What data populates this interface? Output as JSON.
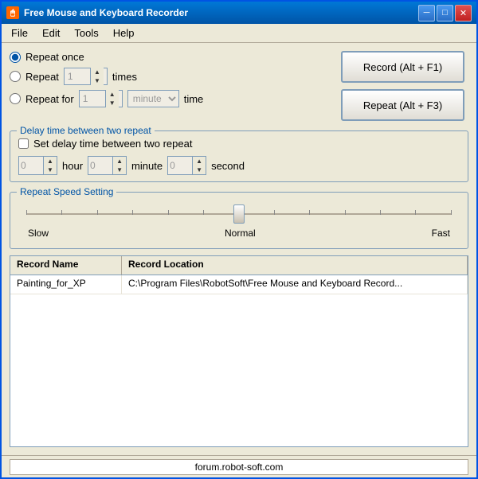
{
  "window": {
    "title": "Free Mouse and Keyboard Recorder",
    "icon": "🖱"
  },
  "titlebar": {
    "minimize_label": "─",
    "maximize_label": "□",
    "close_label": "✕"
  },
  "menu": {
    "items": [
      {
        "label": "File"
      },
      {
        "label": "Edit"
      },
      {
        "label": "Tools"
      },
      {
        "label": "Help"
      }
    ]
  },
  "controls": {
    "repeat_once_label": "Repeat once",
    "repeat_label": "Repeat",
    "repeat_times_value": "1",
    "times_label": "times",
    "repeat_for_label": "Repeat for",
    "repeat_for_value": "1",
    "time_label": "time",
    "minute_option": "minute",
    "record_btn": "Record (Alt + F1)",
    "repeat_btn": "Repeat (Alt + F3)"
  },
  "delay_group": {
    "label": "Delay time between two repeat",
    "checkbox_label": "Set delay time between two repeat",
    "hour_value": "0",
    "hour_label": "hour",
    "minute_value": "0",
    "minute_label": "minute",
    "second_value": "0",
    "second_label": "second"
  },
  "speed_group": {
    "label": "Repeat Speed Setting",
    "slow_label": "Slow",
    "normal_label": "Normal",
    "fast_label": "Fast"
  },
  "table": {
    "col1_header": "Record Name",
    "col2_header": "Record Location",
    "rows": [
      {
        "name": "Painting_for_XP",
        "location": "C:\\Program Files\\RobotSoft\\Free Mouse and Keyboard Record..."
      }
    ]
  },
  "status_bar": {
    "url": "forum.robot-soft.com"
  }
}
